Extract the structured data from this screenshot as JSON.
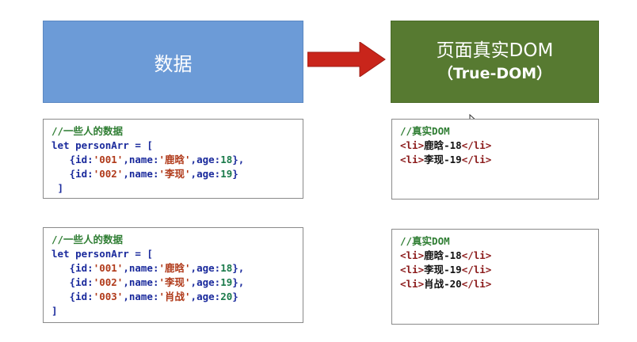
{
  "data_box": {
    "label": "数据"
  },
  "dom_box": {
    "title": "页面真实DOM",
    "subtitle": "（True-DOM）"
  },
  "code_block_1": {
    "comment": "//一些人的数据",
    "declaration": "let personArr = [",
    "rows": [
      {
        "id": "'001'",
        "name": "'鹿晗'",
        "age": "18",
        "tail": "},"
      },
      {
        "id": "'002'",
        "name": "'李现'",
        "age": "19",
        "tail": "}"
      }
    ],
    "close": " ]"
  },
  "code_block_2": {
    "comment": "//一些人的数据",
    "declaration": "let personArr = [",
    "rows": [
      {
        "id": "'001'",
        "name": "'鹿晗'",
        "age": "18",
        "tail": "},"
      },
      {
        "id": "'002'",
        "name": "'李现'",
        "age": "19",
        "tail": "},"
      },
      {
        "id": "'003'",
        "name": "'肖战'",
        "age": "20",
        "tail": "}"
      }
    ],
    "close": "]"
  },
  "dom_block_1": {
    "comment": "//真实DOM",
    "items": [
      "鹿晗-18",
      "李现-19"
    ]
  },
  "dom_block_2": {
    "comment": "//真实DOM",
    "items": [
      "鹿晗-18",
      "李现-19",
      "肖战-20"
    ]
  },
  "syntax": {
    "open_brace": "{",
    "id_key": "id:",
    "name_key": ",name:",
    "age_key": ",age:",
    "li_open": "<li>",
    "li_close": "</li>"
  },
  "colors": {
    "data_box": "#6c9bd7",
    "dom_box": "#577a31",
    "arrow": "#c9251b"
  },
  "icons": {
    "arrow": "right-arrow-icon",
    "cursor": "mouse-cursor-icon"
  }
}
